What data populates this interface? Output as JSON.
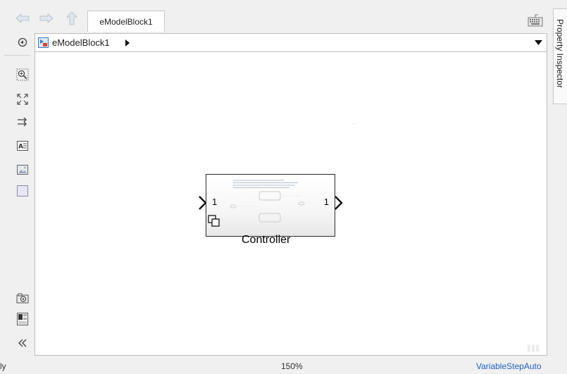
{
  "tab": {
    "label": "eModelBlock1"
  },
  "address": {
    "model_name": "eModelBlock1"
  },
  "side_panel": {
    "label": "Property Inspector"
  },
  "block": {
    "name": "Controller",
    "input_port": "1",
    "output_port": "1"
  },
  "status": {
    "left": "ly",
    "zoom": "150%",
    "solver": "VariableStepAuto"
  },
  "icons": {
    "back": "arrow-left-icon",
    "forward": "arrow-right-icon",
    "up": "arrow-up-icon",
    "keyboard": "keyboard-icon",
    "hide_toolbar": "double-chevron-left-icon"
  },
  "colors": {
    "solver_link": "#1f5fbf",
    "canvas_bg": "#ffffff",
    "chrome_bg": "#f0f0f0"
  }
}
